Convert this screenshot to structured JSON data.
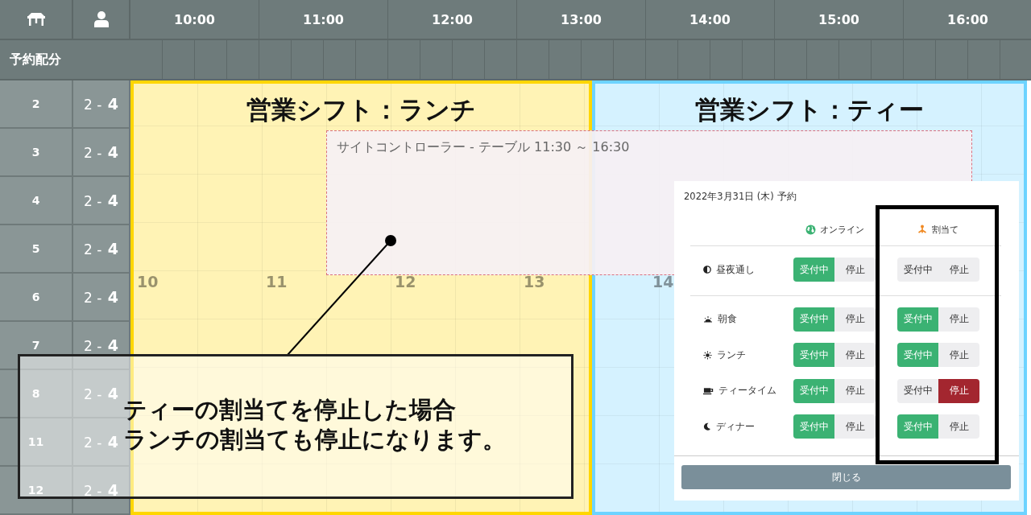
{
  "header": {
    "time_slots": [
      "10:00",
      "11:00",
      "12:00",
      "13:00",
      "14:00",
      "15:00",
      "16:00"
    ]
  },
  "allocation_label": "予約配分",
  "rows": [
    {
      "table": "2",
      "capacity": "2 - **4**"
    },
    {
      "table": "3",
      "capacity": "2 - **4**"
    },
    {
      "table": "4",
      "capacity": "2 - **4**"
    },
    {
      "table": "5",
      "capacity": "2 - **4**"
    },
    {
      "table": "6",
      "capacity": "2 - **4**"
    },
    {
      "table": "7",
      "capacity": "2 - **4**"
    },
    {
      "table": "8",
      "capacity": "2 - **4**"
    },
    {
      "table": "11",
      "capacity": "2 - **4**"
    },
    {
      "table": "12",
      "capacity": "2 - **4**"
    }
  ],
  "hour_labels": [
    "10",
    "11",
    "12",
    "13",
    "14"
  ],
  "shifts": [
    {
      "title": "営業シフト：ランチ",
      "color": "#ffd600"
    },
    {
      "title": "営業シフト：ティー",
      "color": "#6dd3ff"
    }
  ],
  "site_controller": {
    "label": "サイトコントローラー - テーブル 11:30 ～ 16:30"
  },
  "dialog": {
    "title": "2022年3月31日 (木) 予約",
    "columns": [
      {
        "kind": "online",
        "label": "オンライン"
      },
      {
        "kind": "allocation",
        "label": "割当て"
      }
    ],
    "sections": [
      [
        {
          "kind": "all-day",
          "label": "昼夜通し",
          "toggles": [
            [
              {
                "label": "受付中",
                "kind": "open",
                "selected": true
              },
              {
                "label": "停止",
                "kind": "stop",
                "selected": false
              }
            ],
            [
              {
                "label": "受付中",
                "kind": "open",
                "selected": false
              },
              {
                "label": "停止",
                "kind": "stop",
                "selected": false
              }
            ]
          ]
        }
      ],
      [
        {
          "kind": "breakfast",
          "label": "朝食",
          "toggles": [
            [
              {
                "label": "受付中",
                "kind": "open",
                "selected": true
              },
              {
                "label": "停止",
                "kind": "stop",
                "selected": false
              }
            ],
            [
              {
                "label": "受付中",
                "kind": "open",
                "selected": true
              },
              {
                "label": "停止",
                "kind": "stop",
                "selected": false
              }
            ]
          ]
        },
        {
          "kind": "lunch",
          "label": "ランチ",
          "toggles": [
            [
              {
                "label": "受付中",
                "kind": "open",
                "selected": true
              },
              {
                "label": "停止",
                "kind": "stop",
                "selected": false
              }
            ],
            [
              {
                "label": "受付中",
                "kind": "open",
                "selected": true
              },
              {
                "label": "停止",
                "kind": "stop",
                "selected": false
              }
            ]
          ]
        },
        {
          "kind": "tea",
          "label": "ティータイム",
          "toggles": [
            [
              {
                "label": "受付中",
                "kind": "open",
                "selected": true
              },
              {
                "label": "停止",
                "kind": "stop",
                "selected": false
              }
            ],
            [
              {
                "label": "受付中",
                "kind": "open",
                "selected": false
              },
              {
                "label": "停止",
                "kind": "stop",
                "selected": true
              }
            ]
          ]
        },
        {
          "kind": "dinner",
          "label": "ディナー",
          "toggles": [
            [
              {
                "label": "受付中",
                "kind": "open",
                "selected": true
              },
              {
                "label": "停止",
                "kind": "stop",
                "selected": false
              }
            ],
            [
              {
                "label": "受付中",
                "kind": "open",
                "selected": true
              },
              {
                "label": "停止",
                "kind": "stop",
                "selected": false
              }
            ]
          ]
        }
      ]
    ],
    "close_button": "閉じる"
  },
  "callout": {
    "lines": [
      "ティーの割当てを停止した場合",
      "ランチの割当ても停止になります。"
    ]
  }
}
